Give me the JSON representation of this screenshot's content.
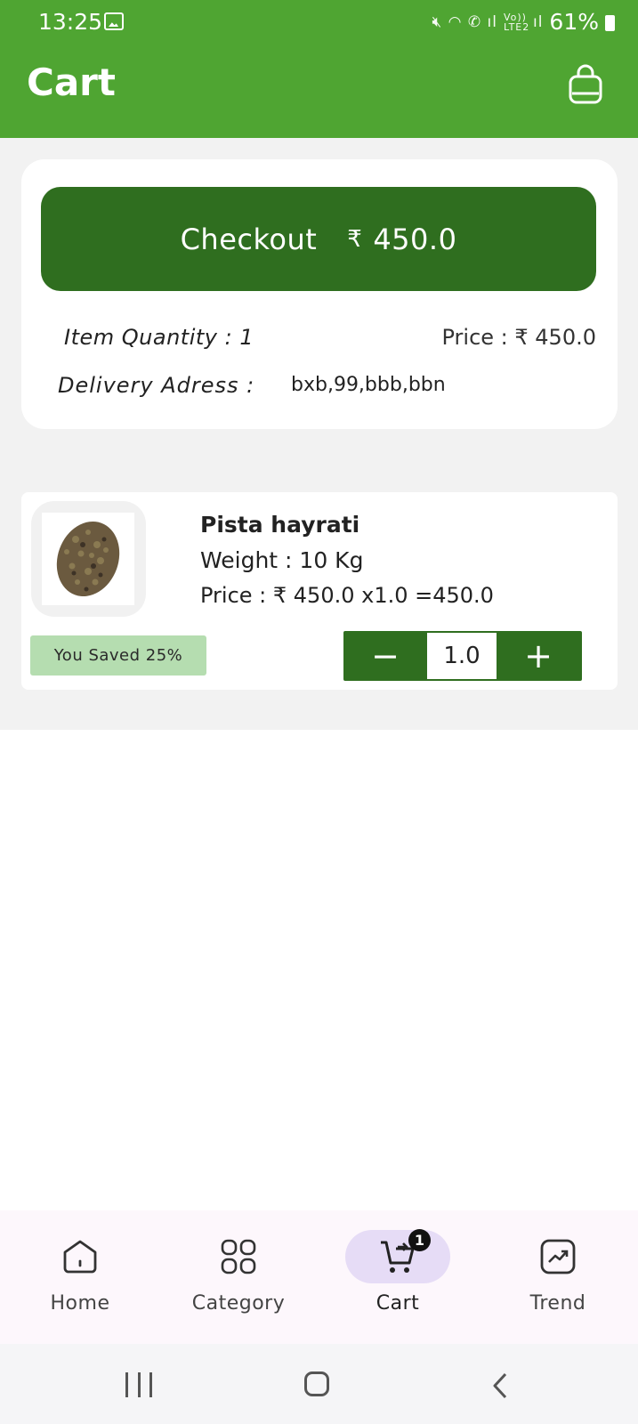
{
  "status_bar": {
    "time": "13:25",
    "battery": "61%",
    "signal_text": "Vo)) LTE2"
  },
  "app_bar": {
    "title": "Cart",
    "cart_bag_icon": "shopping-bag-icon"
  },
  "summary": {
    "checkout_label": "Checkout",
    "currency_symbol": "₹",
    "checkout_amount": "450.0",
    "item_quantity": "Item Quantity : 1",
    "price": "Price :  ₹ 450.0",
    "delivery_label": "Delivery Adress :",
    "delivery_address": "bxb,99,bbb,bbn"
  },
  "cart_items": [
    {
      "name": "Pista hayrati",
      "weight": "Weight : 10 Kg",
      "price_line": "Price :  ₹ 450.0 x1.0 =450.0",
      "saved": "You Saved 25%",
      "quantity": "1.0",
      "decrement": "−",
      "increment": "+"
    }
  ],
  "bottom_nav": {
    "items": [
      {
        "label": "Home",
        "icon": "home-icon",
        "active": false
      },
      {
        "label": "Category",
        "icon": "category-grid-icon",
        "active": false
      },
      {
        "label": "Cart",
        "icon": "cart-icon",
        "active": true,
        "badge": "1"
      },
      {
        "label": "Trend",
        "icon": "trend-icon",
        "active": false
      }
    ]
  },
  "colors": {
    "primary_green": "#4fa532",
    "dark_green": "#2f6e1f",
    "saved_bg": "#b5ddb0",
    "active_pill": "#e6dcf6"
  }
}
